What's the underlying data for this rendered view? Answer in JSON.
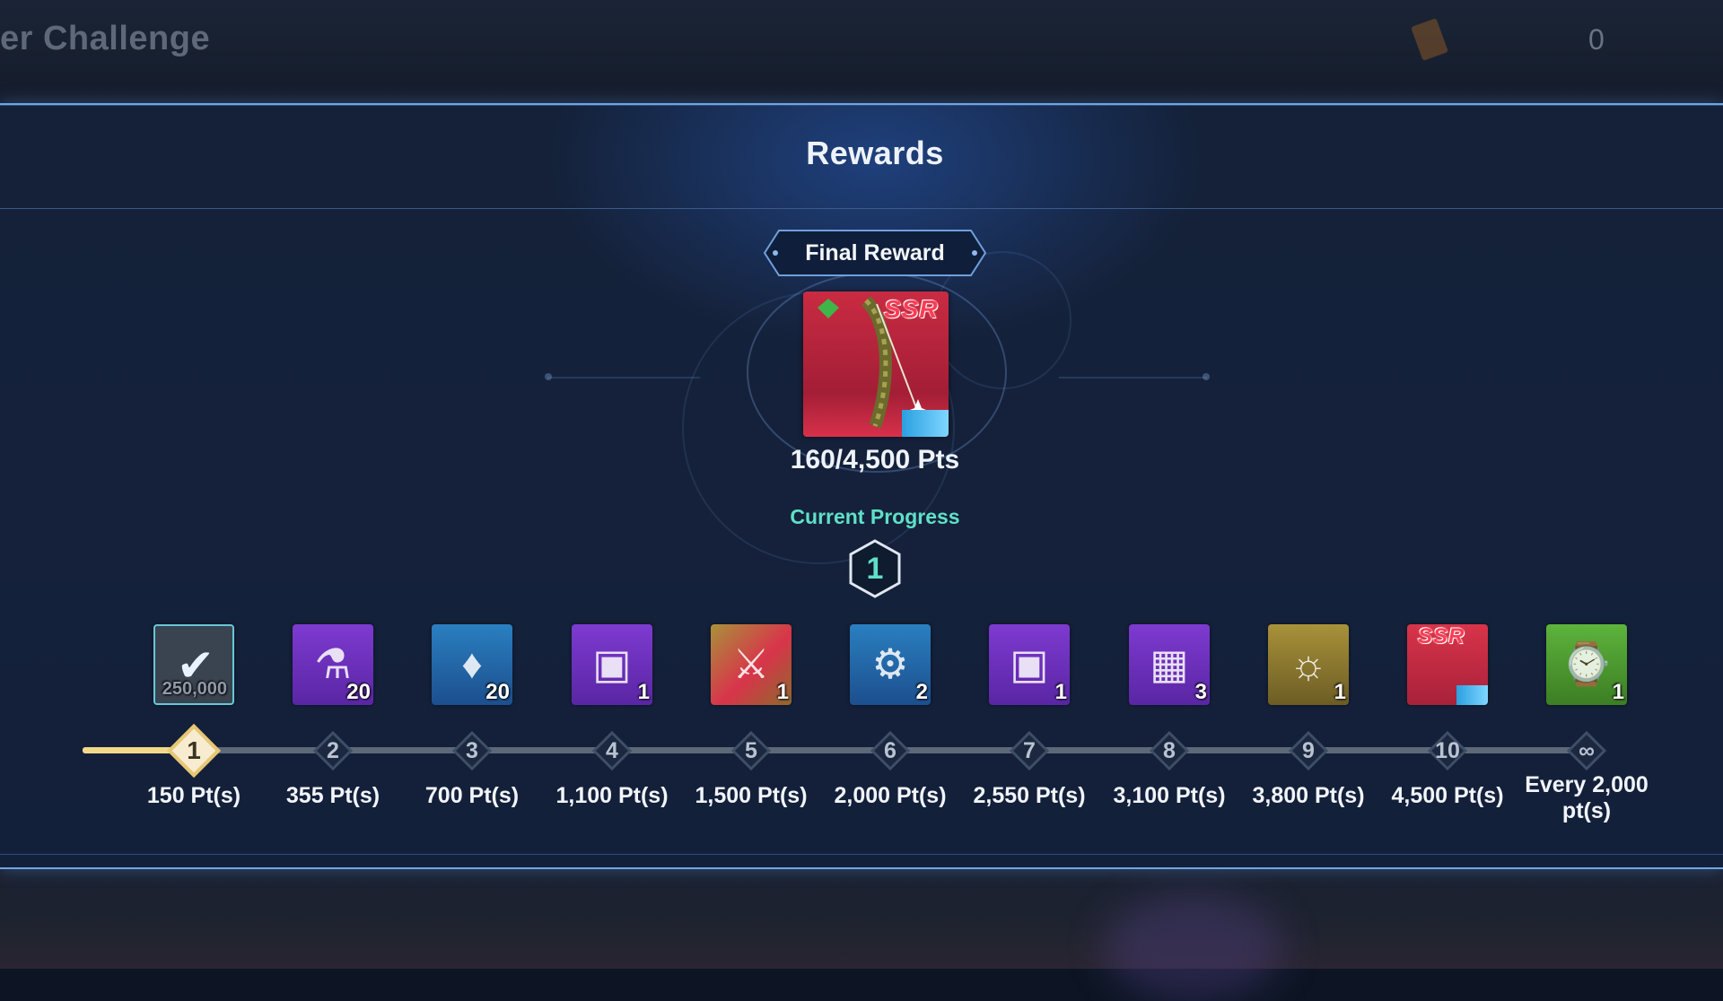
{
  "background": {
    "screen_title": "er Challenge",
    "ticket_count": "0"
  },
  "dialog": {
    "title": "Rewards"
  },
  "final_reward": {
    "tag": "Final Reward",
    "badge": "SSR",
    "progress_text": "160/4,500 Pts",
    "progress_fraction": 0.0356
  },
  "current_progress": {
    "label": "Current Progress",
    "tier": "1"
  },
  "track": {
    "current_tier_index": 0
  },
  "tiers": [
    {
      "tier": "1",
      "points": "150 Pt(s)",
      "item_icon": "claimed-check-icon",
      "quantity": "250,000",
      "bg": "claimed",
      "claimed": true
    },
    {
      "tier": "2",
      "points": "355 Pt(s)",
      "item_icon": "energy-capsule-icon",
      "quantity": "20",
      "bg": "purple",
      "claimed": false
    },
    {
      "tier": "3",
      "points": "700 Pt(s)",
      "item_icon": "blue-crystal-icon",
      "quantity": "20",
      "bg": "blue",
      "claimed": false
    },
    {
      "tier": "4",
      "points": "1,100 Pt(s)",
      "item_icon": "treasure-box-icon",
      "quantity": "1",
      "bg": "purple",
      "claimed": false
    },
    {
      "tier": "5",
      "points": "1,500 Pt(s)",
      "item_icon": "weapon-ticket-icon",
      "quantity": "1",
      "bg": "gold-red",
      "claimed": false
    },
    {
      "tier": "6",
      "points": "2,000 Pt(s)",
      "item_icon": "blueprint-icon",
      "quantity": "2",
      "bg": "blue",
      "claimed": false
    },
    {
      "tier": "7",
      "points": "2,550 Pt(s)",
      "item_icon": "treasure-box-icon",
      "quantity": "1",
      "bg": "purple",
      "claimed": false
    },
    {
      "tier": "8",
      "points": "3,100 Pt(s)",
      "item_icon": "supply-crate-icon",
      "quantity": "3",
      "bg": "purple",
      "claimed": false
    },
    {
      "tier": "9",
      "points": "3,800 Pt(s)",
      "item_icon": "gold-scroll-icon",
      "quantity": "1",
      "bg": "gold",
      "claimed": false
    },
    {
      "tier": "10",
      "points": "4,500 Pt(s)",
      "item_icon": "ssr-bow-icon",
      "quantity": "",
      "badge": "SSR",
      "bg": "red",
      "claimed": false
    },
    {
      "tier": "∞",
      "points": "Every 2,000 pt(s)",
      "item_icon": "time-ticket-icon",
      "quantity": "1",
      "bg": "green",
      "claimed": false
    }
  ],
  "colors": {
    "accent_teal": "#5fe0c8",
    "progress_gold": "#f1d98a",
    "ssr_red": "#ff3c54"
  }
}
